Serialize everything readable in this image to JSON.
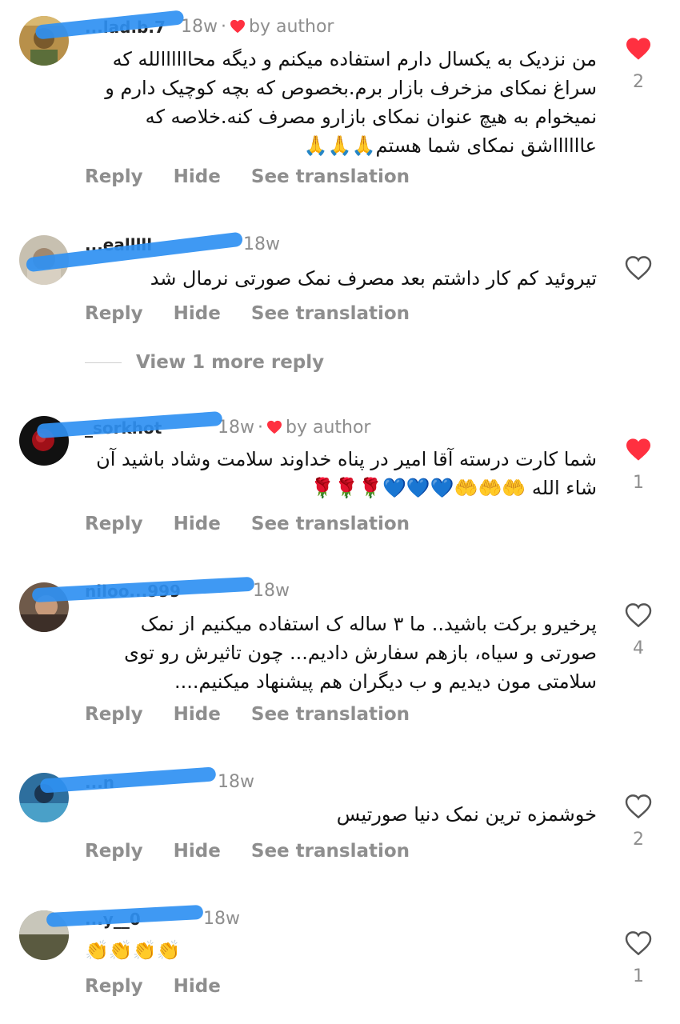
{
  "colors": {
    "like_red": "#ff3040",
    "muted": "#8e8e8e",
    "scribble_blue": "#2f90f2"
  },
  "action_labels": {
    "reply": "Reply",
    "hide": "Hide",
    "see_translation": "See translation"
  },
  "comments": [
    {
      "username": "...lad.b.7",
      "time": "18w",
      "liked_by_author": true,
      "author_label": "by author",
      "text": "من نزدیک به یکسال دارم استفاده میکنم و دیگه محاااااالله که سراغ نمکای مزخرف بازار برم.بخصوص که بچه کوچیک دارم  و نمیخوام به هیچ عنوان نمکای بازارو مصرف کنه.خلاصه که عااااااشق نمکای شما هستم🙏🙏🙏",
      "liked": true,
      "like_count": "2",
      "has_translation": true
    },
    {
      "username": "...ealllll",
      "time": "18w",
      "liked_by_author": false,
      "text": "تیروئید کم کار داشتم بعد مصرف نمک صورتی نرمال شد",
      "liked": false,
      "like_count": "",
      "has_translation": true
    },
    {
      "username": "_sorkhot",
      "time": "18w",
      "liked_by_author": true,
      "author_label": "by author",
      "text": "شما کارت درسته آقا امیر در پناه خداوند سلامت وشاد باشید آن شاء الله 🤲🤲🤲💙💙💙🌹🌹🌹",
      "liked": true,
      "like_count": "1",
      "has_translation": true
    },
    {
      "username": "niloo...999",
      "time": "18w",
      "liked_by_author": false,
      "text": "پرخیرو برکت باشید.. ما ۳ ساله ک استفاده میکنیم از نمک صورتی و سیاه، بازهم سفارش دادیم... چون تاثیرش رو توی سلامتی مون دیدیم و ب دیگران هم پیشنهاد میکنیم....",
      "liked": false,
      "like_count": "4",
      "has_translation": true
    },
    {
      "username": "...n",
      "time": "18w",
      "liked_by_author": false,
      "text": "خوشمزه ترین نمک دنیا صورتیس",
      "liked": false,
      "like_count": "2",
      "has_translation": true
    },
    {
      "username": "...y__0",
      "time": "18w",
      "liked_by_author": false,
      "text": "👏👏👏👏",
      "liked": false,
      "like_count": "1",
      "has_translation": false
    }
  ],
  "more_replies": "View 1 more reply"
}
